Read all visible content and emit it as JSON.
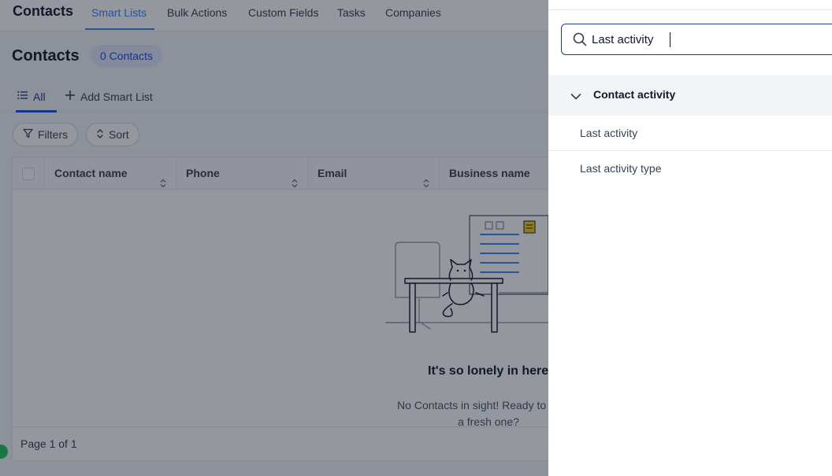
{
  "app": {
    "title": "Contacts",
    "nav_tabs": [
      {
        "label": "Smart Lists",
        "active": true
      },
      {
        "label": "Bulk Actions"
      },
      {
        "label": "Custom Fields"
      },
      {
        "label": "Tasks"
      },
      {
        "label": "Companies"
      }
    ]
  },
  "page": {
    "title": "Contacts",
    "count_badge": "0 Contacts"
  },
  "list_tabs": {
    "all": "All",
    "add": "Add Smart List"
  },
  "toolbar": {
    "filters": "Filters",
    "sort": "Sort"
  },
  "table": {
    "columns": [
      "Contact name",
      "Phone",
      "Email",
      "Business name"
    ],
    "empty_title": "It's so lonely in here",
    "empty_desc": "No Contacts in sight! Ready to create a fresh one?",
    "pagination": "Page 1 of 1"
  },
  "drawer": {
    "search": {
      "value": "Last activity",
      "placeholder": "Search"
    },
    "group": {
      "label": "Contact activity",
      "options": [
        "Last activity",
        "Last activity type"
      ]
    }
  },
  "colors": {
    "accent": "#3b82f6",
    "primary_dark": "#1e3a8a",
    "badge_bg": "#e0e7ff",
    "status_green": "#22c55e"
  },
  "icons": [
    "search-icon",
    "chevron-down-icon",
    "list-icon",
    "plus-icon",
    "filter-icon",
    "sort-icon"
  ]
}
